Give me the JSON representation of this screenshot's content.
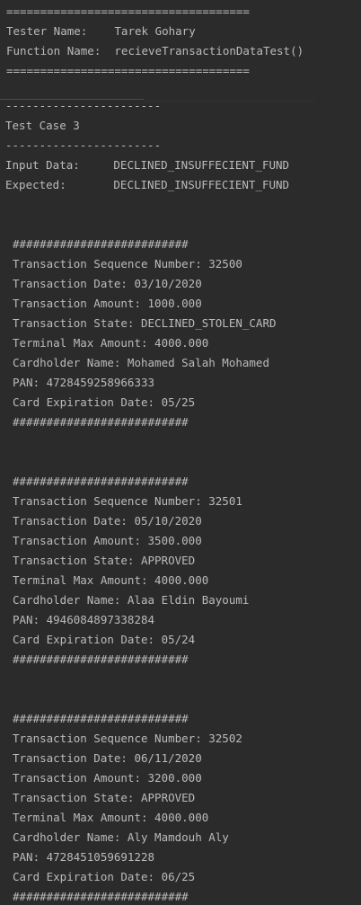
{
  "header": {
    "rule_top": "====================================",
    "tester_line": "Tester Name:    Tarek Gohary",
    "function_line": "Function Name:  recieveTransactionDataTest()",
    "rule_bottom": "===================================="
  },
  "test_case": {
    "rule_top": "-----------------------",
    "title": "Test Case 3",
    "rule_bottom": "-----------------------",
    "input_line": "Input Data:     DECLINED_INSUFFECIENT_FUND",
    "expected_line": "Expected:       DECLINED_INSUFFECIENT_FUND"
  },
  "records": [
    {
      "border": "##########################",
      "seq": "Transaction Sequence Number: 32500",
      "date": "Transaction Date: 03/10/2020",
      "amount": "Transaction Amount: 1000.000",
      "state": "Transaction State: DECLINED_STOLEN_CARD",
      "max": "Terminal Max Amount: 4000.000",
      "name": "Cardholder Name: Mohamed Salah Mohamed",
      "pan": "PAN: 4728459258966333",
      "expiry": "Card Expiration Date: 05/25"
    },
    {
      "border": "##########################",
      "seq": "Transaction Sequence Number: 32501",
      "date": "Transaction Date: 05/10/2020",
      "amount": "Transaction Amount: 3500.000",
      "state": "Transaction State: APPROVED",
      "max": "Terminal Max Amount: 4000.000",
      "name": "Cardholder Name: Alaa Eldin Bayoumi",
      "pan": "PAN: 4946084897338284",
      "expiry": "Card Expiration Date: 05/24"
    },
    {
      "border": "##########################",
      "seq": "Transaction Sequence Number: 32502",
      "date": "Transaction Date: 06/11/2020",
      "amount": "Transaction Amount: 3200.000",
      "state": "Transaction State: APPROVED",
      "max": "Terminal Max Amount: 4000.000",
      "name": "Cardholder Name: Aly Mamdouh Aly",
      "pan": "PAN: 4728451059691228",
      "expiry": "Card Expiration Date: 06/25"
    }
  ],
  "colors": {
    "background": "#2b2b2b",
    "text": "#bbbbbb"
  }
}
